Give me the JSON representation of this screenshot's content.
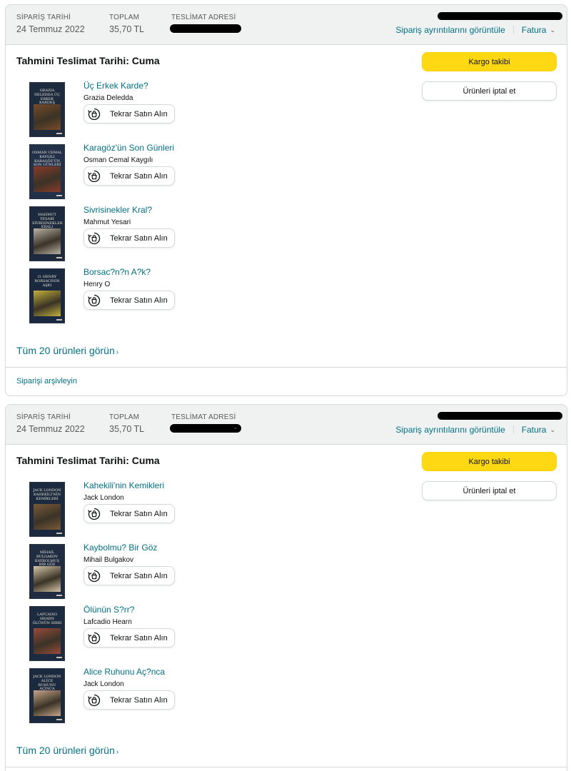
{
  "orders": [
    {
      "header": {
        "date_label": "SİPARİŞ TARİHİ",
        "date": "24 Temmuz 2022",
        "total_label": "TOPLAM",
        "total": "35,70 TL",
        "address_label": "TESLİMAT ADRESİ",
        "details_link": "Sipariş ayrıntılarını görüntüle",
        "invoice_link": "Fatura"
      },
      "delivery": "Tahmini Teslimat Tarihi: Cuma",
      "track_button": "Kargo takibi",
      "cancel_button": "Ürünleri iptal et",
      "items": [
        {
          "title": "Üç Erkek Karde?",
          "author": "Grazia Deledda",
          "buy_again": "Tekrar Satın Alın",
          "cover_text": "GRAZIA DELEDDA ÜÇ ERKEK KARDEŞ",
          "cover_color": "#1e2b3f",
          "art_color": "#7a4a2a"
        },
        {
          "title": "Karagöz'ün Son Günleri",
          "author": "Osman Cemal Kaygılı",
          "buy_again": "Tekrar Satın Alın",
          "cover_text": "OSMAN CEMAL KAYGILI KARAGÖZ'ÜN SON GÜNLERİ",
          "cover_color": "#22304a",
          "art_color": "#8b3a2a"
        },
        {
          "title": "Sivrisinekler Kral?",
          "author": "Mahmut Yesari",
          "buy_again": "Tekrar Satın Alın",
          "cover_text": "MAHMUT YESARİ SİVRİSİNEKLER KRALI",
          "cover_color": "#1d2a3e",
          "art_color": "#b8b2a6"
        },
        {
          "title": "Borsac?n?n A?k?",
          "author": "Henry O",
          "buy_again": "Tekrar Satın Alın",
          "cover_text": "O. HENRY BORSACININ AŞKI",
          "cover_color": "#1b2940",
          "art_color": "#c4b03a"
        }
      ],
      "see_all": "Tüm 20 ürünleri görün",
      "archive": "Siparişi arşivleyin"
    },
    {
      "header": {
        "date_label": "SİPARİŞ TARİHİ",
        "date": "24 Temmuz 2022",
        "total_label": "TOPLAM",
        "total": "35,70 TL",
        "address_label": "TESLİMAT ADRESİ",
        "details_link": "Sipariş ayrıntılarını görüntüle",
        "invoice_link": "Fatura"
      },
      "delivery": "Tahmini Teslimat Tarihi: Cuma",
      "track_button": "Kargo takibi",
      "cancel_button": "Ürünleri iptal et",
      "items": [
        {
          "title": "Kahekili'nin Kemikleri",
          "author": "Jack London",
          "buy_again": "Tekrar Satın Alın",
          "cover_text": "JACK LONDON KAHEKİLİ'NİN KEMİKLERİ",
          "cover_color": "#1c2a40",
          "art_color": "#7b5a3a"
        },
        {
          "title": "Kaybolmu? Bir Göz",
          "author": "Mihail Bulgakov",
          "buy_again": "Tekrar Satın Alın",
          "cover_text": "MİHAİL BULGAKOV KAYBOLMUŞ BİR GÖZ",
          "cover_color": "#1f2c42",
          "art_color": "#d6c6a8"
        },
        {
          "title": "Ölünün S?rr?",
          "author": "Lafcadio Hearn",
          "buy_again": "Tekrar Satın Alın",
          "cover_text": "LAFCADIO HEARN ÖLÜNÜN SIRRI",
          "cover_color": "#1d2b41",
          "art_color": "#9a4a3a"
        },
        {
          "title": "Alice Ruhunu Aç?nca",
          "author": "Jack London",
          "buy_again": "Tekrar Satın Alın",
          "cover_text": "JACK LONDON ALİCE RUHUNU AÇINCA",
          "cover_color": "#1c2a3f",
          "art_color": "#c7a58a"
        }
      ],
      "see_all": "Tüm 20 ürünleri görün"
    }
  ],
  "icons": {
    "buy_again": "buy-again-icon",
    "caret": "chevron-down-icon",
    "see_all_chevron": "chevron-right-icon"
  },
  "colors": {
    "link": "#007185",
    "track_button": "#ffd814",
    "header_bg": "#f0f2f2",
    "border": "#d5d9d9"
  }
}
